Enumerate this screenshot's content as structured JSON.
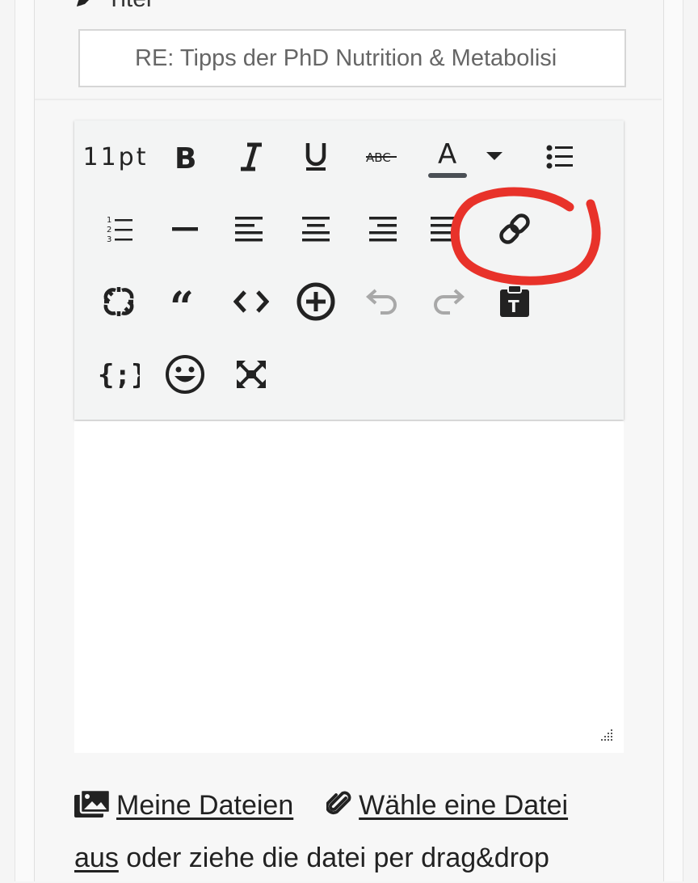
{
  "form": {
    "title_label": "Titel",
    "title_value": "RE: Tipps der PhD Nutrition & Metabolisi"
  },
  "toolbar": {
    "font_size": "11pt",
    "buttons": [
      {
        "name": "bold-button",
        "icon": "bold-icon"
      },
      {
        "name": "italic-button",
        "icon": "italic-icon"
      },
      {
        "name": "underline-button",
        "icon": "underline-icon"
      },
      {
        "name": "strikethrough-button",
        "icon": "strikethrough-icon"
      },
      {
        "name": "text-color-button",
        "icon": "text-color-icon"
      },
      {
        "name": "text-color-dropdown",
        "icon": "caret-down-icon"
      },
      {
        "name": "bulleted-list-button",
        "icon": "bulleted-list-icon"
      },
      {
        "name": "numbered-list-button",
        "icon": "numbered-list-icon"
      },
      {
        "name": "horizontal-rule-button",
        "icon": "horizontal-rule-icon"
      },
      {
        "name": "align-left-button",
        "icon": "align-left-icon"
      },
      {
        "name": "align-center-button",
        "icon": "align-center-icon"
      },
      {
        "name": "align-right-button",
        "icon": "align-right-icon"
      },
      {
        "name": "align-justify-button",
        "icon": "align-justify-icon"
      },
      {
        "name": "insert-link-button",
        "icon": "link-icon"
      },
      {
        "name": "unlink-button",
        "icon": "unlink-icon"
      },
      {
        "name": "quote-button",
        "icon": "quote-icon"
      },
      {
        "name": "code-button",
        "icon": "code-icon"
      },
      {
        "name": "insert-button",
        "icon": "plus-circle-icon"
      },
      {
        "name": "undo-button",
        "icon": "undo-icon"
      },
      {
        "name": "redo-button",
        "icon": "redo-icon"
      },
      {
        "name": "paste-text-button",
        "icon": "paste-text-icon"
      },
      {
        "name": "source-code-button",
        "icon": "curly-braces-icon"
      },
      {
        "name": "emoji-button",
        "icon": "smiley-icon"
      },
      {
        "name": "fullscreen-button",
        "icon": "fullscreen-icon"
      }
    ],
    "text_color_underline": "#4a4f55",
    "disabled_color": "#a8a8a8"
  },
  "attachments": {
    "my_files_link": "Meine Dateien",
    "choose_file_link_part1": "Wähle eine Datei",
    "choose_file_link_part2": "aus",
    "drag_text": "oder ziehe die datei per drag&drop"
  },
  "annotation": {
    "color": "#e8322a"
  }
}
